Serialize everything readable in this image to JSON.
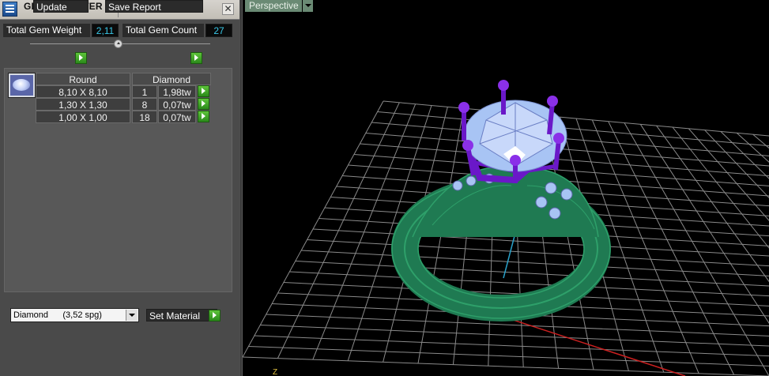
{
  "window": {
    "title": "GEM REPORTER",
    "close_glyph": "✕",
    "app_icon": "gem-reporter-icon"
  },
  "stats": {
    "weight_label": "Total Gem Weight",
    "weight_value": "2,11",
    "count_label": "Total Gem Count",
    "count_value": "27"
  },
  "actions": {
    "update_label": "Update",
    "save_report_label": "Save Report"
  },
  "gem_table": {
    "thumbnail_icon": "round-gem-icon",
    "headers": [
      "Round",
      "Diamond"
    ],
    "rows": [
      {
        "size": "8,10 X 8,10",
        "count": "1",
        "weight": "1,98tw"
      },
      {
        "size": "1,30 X 1,30",
        "count": "8",
        "weight": "0,07tw"
      },
      {
        "size": "1,00 X 1,00",
        "count": "18",
        "weight": "0,07tw"
      }
    ]
  },
  "material": {
    "selected": "Diamond      (3,52 spg)",
    "set_label": "Set Material"
  },
  "viewport": {
    "view_label": "Perspective",
    "axis_label": "Z"
  },
  "colors": {
    "panel_bg": "#4a4a4a",
    "value_text": "#39c8e8",
    "button_green": "#3aa82a",
    "viewport_tab": "#6a8a74",
    "grid": "#8a8a8a",
    "ring_metal": "#1f7a52",
    "prongs": "#6a18c8",
    "gemstone": "#a8c4f4",
    "axis_x": "#cc2020",
    "axis_z": "#29a0c8"
  }
}
